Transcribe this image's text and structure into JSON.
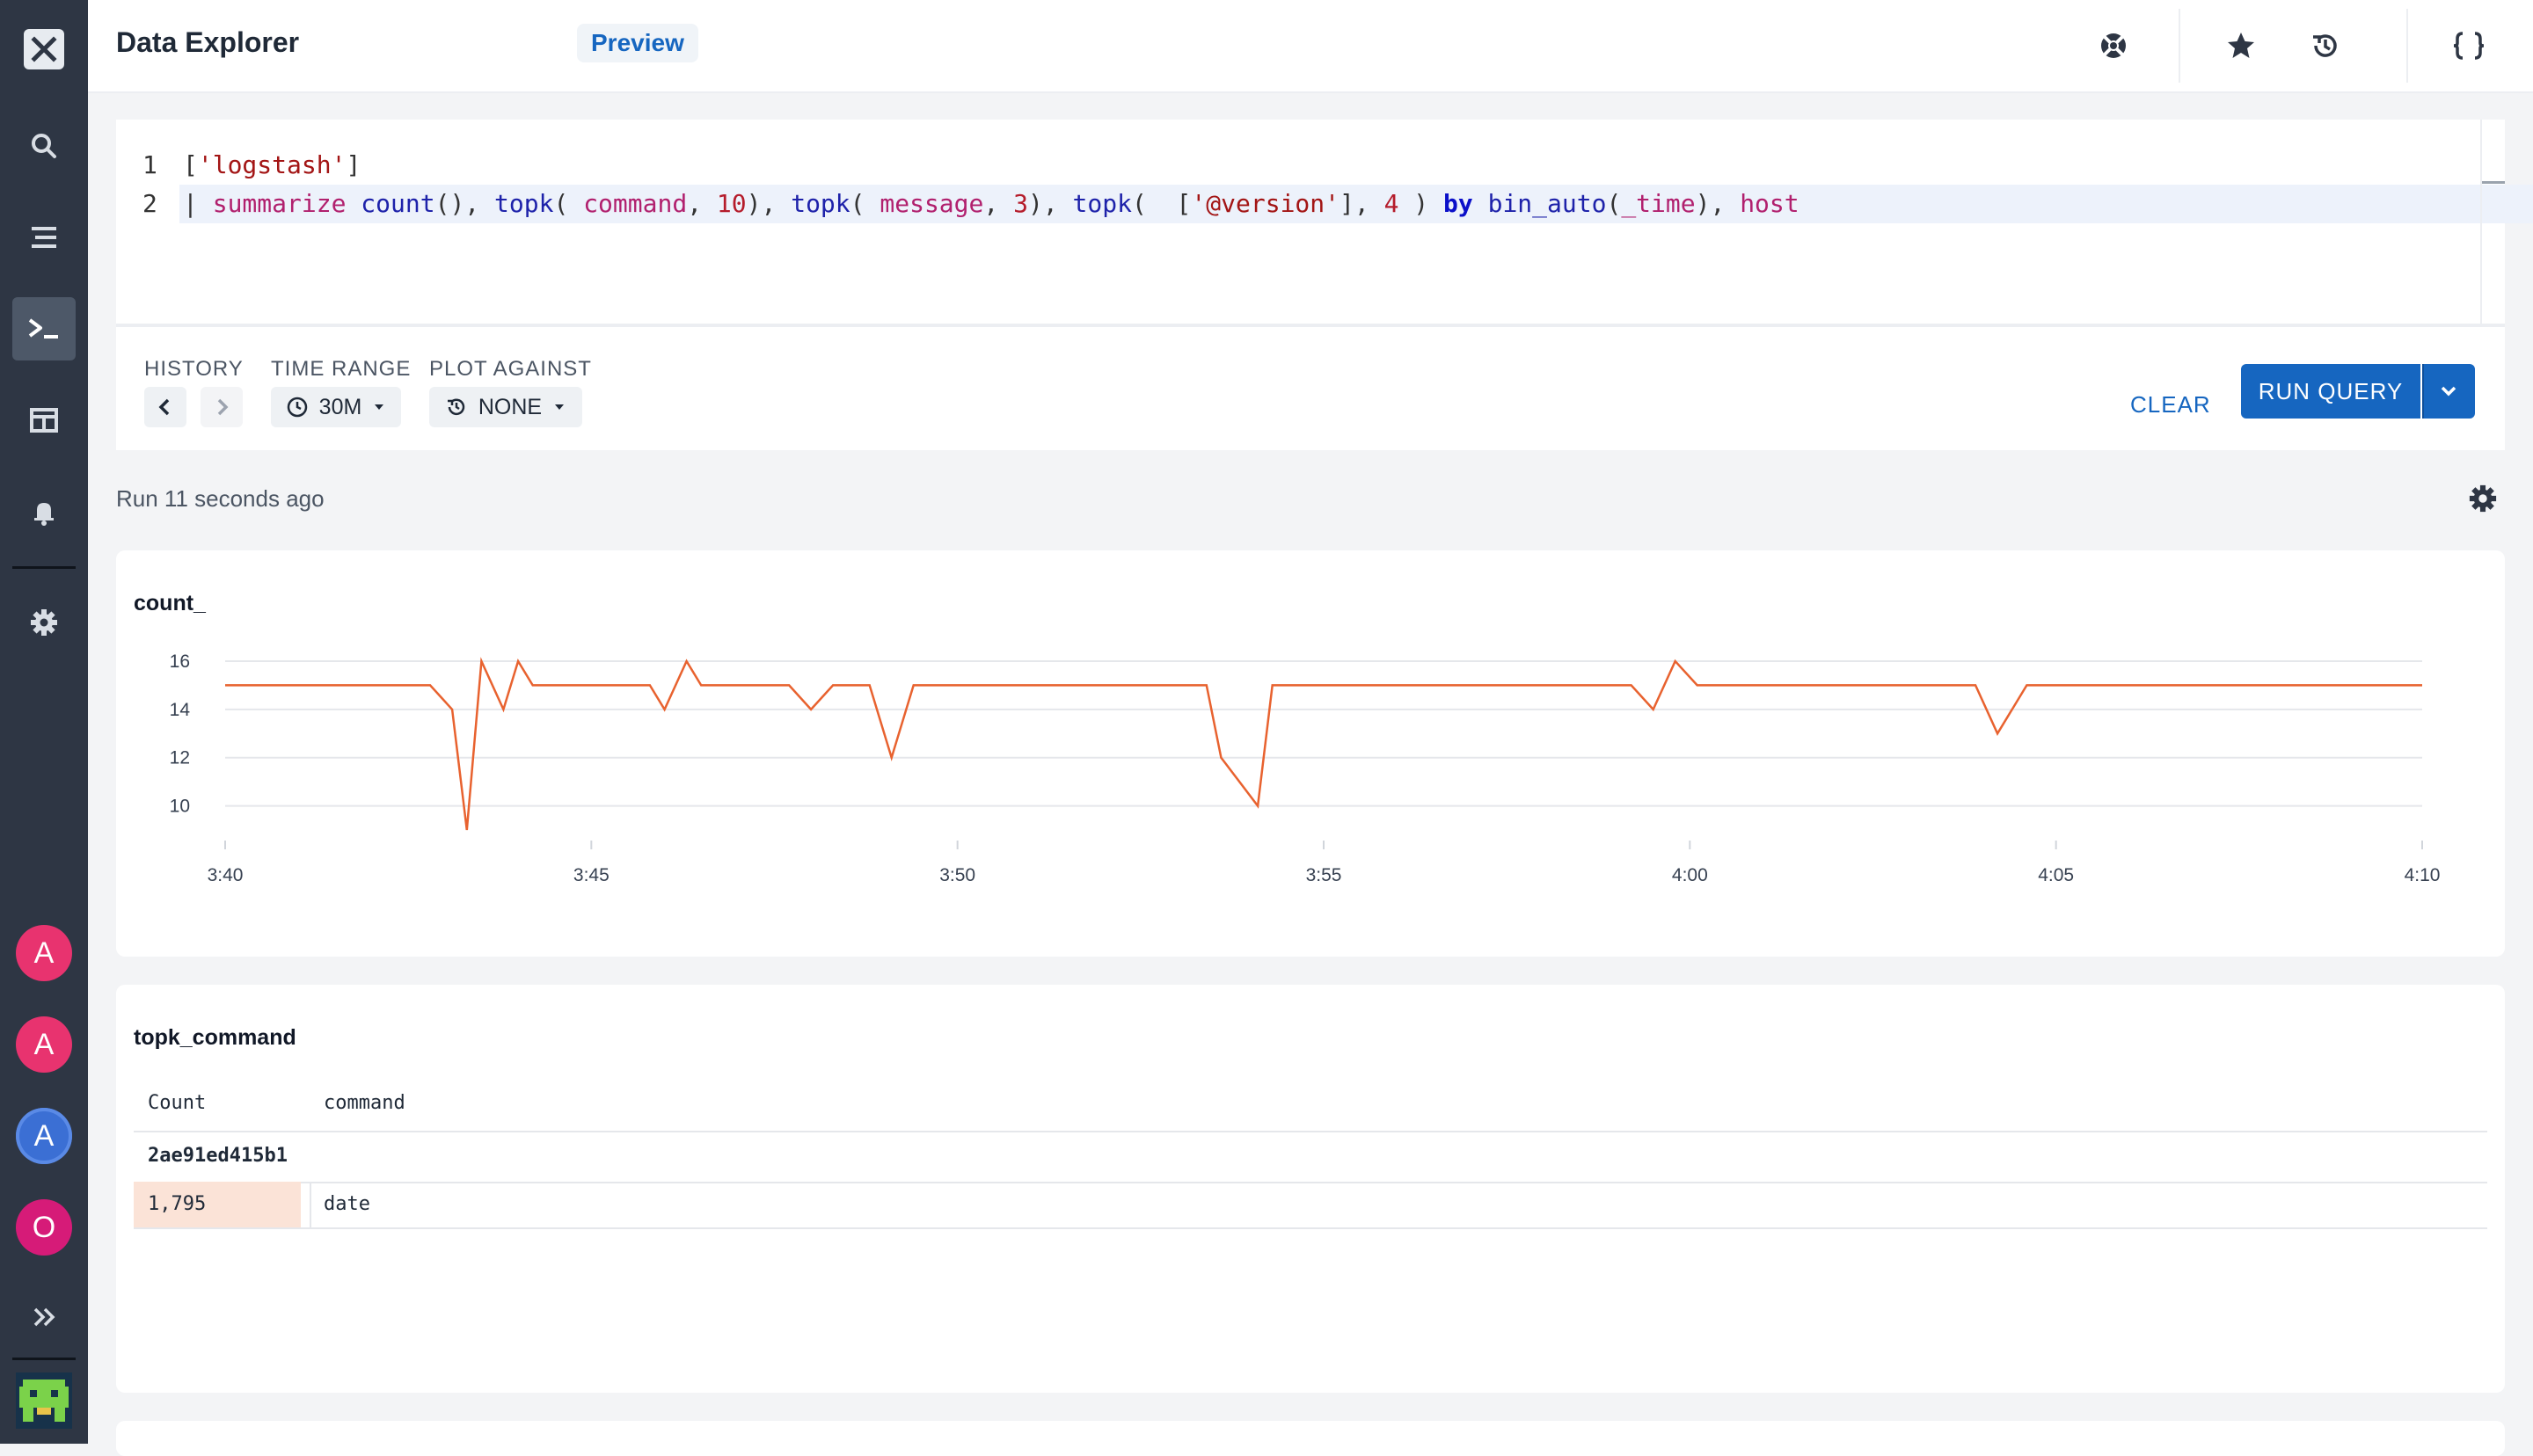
{
  "app": {
    "page_title": "Data Explorer",
    "preview_label": "Preview"
  },
  "header_icons": [
    "help-icon",
    "star-icon",
    "history-icon",
    "braces-icon"
  ],
  "sidebar": {
    "items": [
      "search",
      "datasets",
      "query",
      "dashboards",
      "monitors",
      "settings"
    ],
    "active": "query",
    "avatars": [
      {
        "letter": "A",
        "color": "#e8336f"
      },
      {
        "letter": "A",
        "color": "#e8336f"
      },
      {
        "letter": "A",
        "color": "#3b6fd4"
      },
      {
        "letter": "O",
        "color": "#d61b78"
      }
    ]
  },
  "editor": {
    "line_numbers": [
      "1",
      "2"
    ],
    "line1": {
      "open": "[",
      "str": "'logstash'",
      "close": "]"
    },
    "line2": {
      "pipe": "| ",
      "summarize": "summarize",
      "count_fn": "count",
      "count_args": "(), ",
      "topk1": "topk",
      "topk1_open": "( ",
      "command": "command",
      "comma1": ", ",
      "num1": "10",
      "close1": "), ",
      "topk2": "topk",
      "topk2_open": "( ",
      "message": "message",
      "comma2": ", ",
      "num2": "3",
      "close2": "), ",
      "topk3": "topk",
      "topk3_open": "(  [",
      "version": "'@version'",
      "close3a": "], ",
      "num3": "4",
      "close3b": " ) ",
      "by": "by",
      "space": " ",
      "bin_auto": "bin_auto",
      "bin_open": "(",
      "time": "_time",
      "bin_close": "), ",
      "host": "host"
    }
  },
  "toolbar": {
    "history_label": "HISTORY",
    "time_range_label": "TIME RANGE",
    "time_range_value": "30M",
    "plot_against_label": "PLOT AGAINST",
    "plot_against_value": "NONE",
    "clear_label": "CLEAR",
    "run_label": "RUN QUERY"
  },
  "status": {
    "run_text": "Run 11 seconds ago"
  },
  "chart_data": {
    "type": "line",
    "title": "count_",
    "xlabel": "",
    "ylabel": "",
    "x_ticks": [
      "3:40",
      "3:45",
      "3:50",
      "3:55",
      "4:00",
      "4:05",
      "4:10"
    ],
    "y_ticks": [
      10,
      12,
      14,
      16
    ],
    "xlim": [
      0,
      30
    ],
    "ylim": [
      9,
      16
    ],
    "grid": true,
    "series": [
      {
        "color": "#e8622f",
        "points": [
          [
            0,
            15
          ],
          [
            1,
            15
          ],
          [
            2,
            15
          ],
          [
            2.8,
            15
          ],
          [
            3.1,
            14
          ],
          [
            3.3,
            9
          ],
          [
            3.5,
            16
          ],
          [
            3.8,
            14
          ],
          [
            4,
            16
          ],
          [
            4.2,
            15
          ],
          [
            5,
            15
          ],
          [
            5.8,
            15
          ],
          [
            6,
            14
          ],
          [
            6.3,
            16
          ],
          [
            6.5,
            15
          ],
          [
            7,
            15
          ],
          [
            7.7,
            15
          ],
          [
            8,
            14
          ],
          [
            8.3,
            15
          ],
          [
            8.8,
            15
          ],
          [
            9.1,
            12
          ],
          [
            9.4,
            15
          ],
          [
            10,
            15
          ],
          [
            11,
            15
          ],
          [
            12,
            15
          ],
          [
            13.4,
            15
          ],
          [
            13.6,
            12
          ],
          [
            14.1,
            10
          ],
          [
            14.3,
            15
          ],
          [
            15,
            15
          ],
          [
            16,
            15
          ],
          [
            17,
            15
          ],
          [
            18,
            15
          ],
          [
            19,
            15
          ],
          [
            19.2,
            15
          ],
          [
            19.5,
            14
          ],
          [
            19.8,
            16
          ],
          [
            20.1,
            15
          ],
          [
            21,
            15
          ],
          [
            22,
            15
          ],
          [
            23,
            15
          ],
          [
            23.9,
            15
          ],
          [
            24.2,
            13
          ],
          [
            24.6,
            15
          ],
          [
            25,
            15
          ],
          [
            26,
            15
          ],
          [
            27,
            15
          ],
          [
            28,
            15
          ],
          [
            29,
            15
          ],
          [
            30,
            15
          ]
        ]
      }
    ]
  },
  "table": {
    "title": "topk_command",
    "columns": [
      "Count",
      "command"
    ],
    "group": "2ae91ed415b1",
    "rows": [
      {
        "count": "1,795",
        "command": "date"
      }
    ]
  }
}
